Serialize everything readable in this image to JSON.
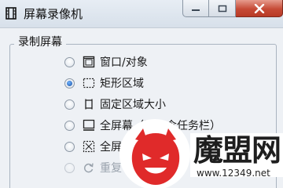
{
  "window": {
    "title": "屏幕录像机",
    "icon": "film-strip-icon",
    "controls": {
      "minimize": "minimize-icon",
      "maximize": "maximize-icon",
      "close": "close-icon"
    }
  },
  "group": {
    "label": "录制屏幕",
    "options": [
      {
        "label": "窗口/对象",
        "icon": "window-object-icon",
        "checked": false,
        "enabled": true
      },
      {
        "label": "矩形区域",
        "icon": "rectangle-selection-icon",
        "checked": true,
        "enabled": true
      },
      {
        "label": "固定区域大小",
        "icon": "fixed-area-icon",
        "checked": false,
        "enabled": true
      },
      {
        "label": "全屏幕（不包含任务栏）",
        "icon": "fullscreen-no-taskbar-icon",
        "checked": false,
        "enabled": true
      },
      {
        "label": "全屏",
        "icon": "fullscreen-icon",
        "checked": false,
        "enabled": true
      },
      {
        "label": "重复",
        "icon": "repeat-icon",
        "checked": false,
        "enabled": false
      }
    ]
  },
  "watermark": {
    "brand": "魔盟网",
    "url": "www.12349.net"
  },
  "colors": {
    "titlebar": "#dfe6ee",
    "close_button": "#c64a36",
    "radio_selected": "#1a4fa0",
    "watermark_red": "#e02a2a"
  }
}
